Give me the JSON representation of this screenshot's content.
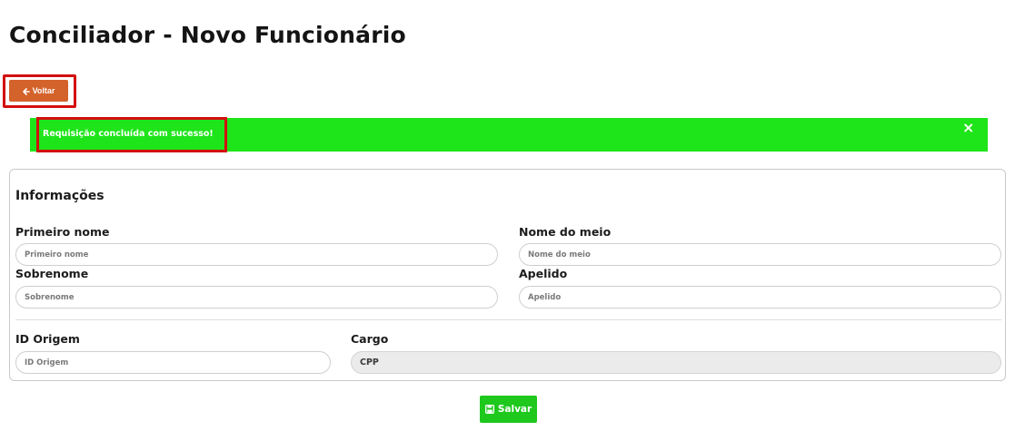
{
  "page": {
    "title": "Conciliador - Novo Funcionário"
  },
  "toolbar": {
    "back_label": "Voltar",
    "back_icon": "arrow-left-icon"
  },
  "alert": {
    "message": "Requisição concluída com sucesso!",
    "close_symbol": "×",
    "color": "#1ee51a"
  },
  "form": {
    "section_title": "Informações",
    "first_name": {
      "label": "Primeiro nome",
      "placeholder": "Primeiro nome",
      "value": ""
    },
    "middle_name": {
      "label": "Nome do meio",
      "placeholder": "Nome do meio",
      "value": ""
    },
    "last_name": {
      "label": "Sobrenome",
      "placeholder": "Sobrenome",
      "value": ""
    },
    "nickname": {
      "label": "Apelido",
      "placeholder": "Apelido",
      "value": ""
    },
    "origin_id": {
      "label": "ID Origem",
      "placeholder": "ID Origem",
      "value": ""
    },
    "role": {
      "label": "Cargo",
      "value": "CPP"
    }
  },
  "actions": {
    "save_label": "Salvar",
    "save_icon": "floppy-disk-icon"
  },
  "colors": {
    "back_button": "#d4622b",
    "save_button": "#1ec81d",
    "highlight": "#d20f0f"
  }
}
